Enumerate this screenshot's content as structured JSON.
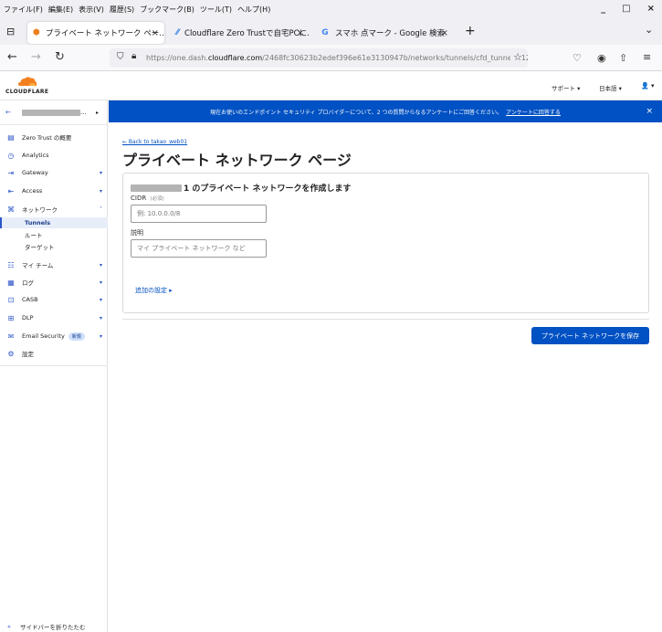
{
  "menubar": {
    "items": [
      "ファイル(F)",
      "編集(E)",
      "表示(V)",
      "履歴(S)",
      "ブックマーク(B)",
      "ツール(T)",
      "ヘルプ(H)"
    ],
    "minimize": "_",
    "maximize": "□",
    "close": "×"
  },
  "tabs": [
    {
      "label": "プライベート ネットワーク ペー…",
      "active": true
    },
    {
      "label": "Cloudflare Zero Trustで自宅PCに…",
      "active": false
    },
    {
      "label": "スマホ 点マーク - Google 検索",
      "active": false
    }
  ],
  "new_tab": "+",
  "tab_list": "⌄",
  "navbar": {
    "url_prefix": "https://one.dash.",
    "url_domain": "cloudflare.com",
    "url_rest": "/2468fc30623b2edef396e61e3130947b/networks/tunnels/cfd_tunnel/b12bf..."
  },
  "header": {
    "logo_text": "CLOUDFLARE",
    "support": "サポート ▾",
    "language": "日本語 ▾",
    "user": "👤 ▾"
  },
  "sidebar": {
    "account_suffix": "...",
    "items": [
      {
        "label": "Zero Trust の概要",
        "icon": "grid-icon",
        "chevron": ""
      },
      {
        "label": "Analytics",
        "icon": "clock-icon",
        "chevron": ""
      },
      {
        "label": "Gateway",
        "icon": "gateway-icon",
        "chevron": "▾"
      },
      {
        "label": "Access",
        "icon": "access-icon",
        "chevron": "▾"
      },
      {
        "label": "ネットワーク",
        "icon": "network-icon",
        "chevron": "˄"
      }
    ],
    "subitems": [
      "Tunnels",
      "ルート",
      "ターゲット"
    ],
    "items2": [
      {
        "label": "マイ チーム",
        "icon": "team-icon",
        "chevron": "▾"
      },
      {
        "label": "ログ",
        "icon": "log-icon",
        "chevron": "▾"
      },
      {
        "label": "CASB",
        "icon": "casb-icon",
        "chevron": "▾"
      },
      {
        "label": "DLP",
        "icon": "dlp-icon",
        "chevron": "▾"
      },
      {
        "label": "Email Security",
        "icon": "email-icon",
        "chevron": "▾",
        "badge": "新規"
      },
      {
        "label": "設定",
        "icon": "gear-icon",
        "chevron": ""
      }
    ],
    "collapse": "サイドバーを折りたたむ"
  },
  "banner": {
    "text": "現在お使いのエンドポイント セキュリティ プロバイダーについて、2 つの質問からなるアンケートにご回答ください。",
    "link": "アンケートに回答する",
    "close": "×"
  },
  "main": {
    "back_link": "← Back to takao_web01",
    "title": "プライベート ネットワーク ページ",
    "card_title_suffix": "1 のプライベート ネットワークを作成します",
    "cidr_label": "CIDR",
    "cidr_required": "(必須)",
    "cidr_placeholder": "例: 10.0.0.0/8",
    "desc_label": "説明",
    "desc_placeholder": "マイ プライベート ネットワーク など",
    "advanced": "追加の設定 ▸",
    "save_button": "プライベート ネットワークを保存"
  }
}
